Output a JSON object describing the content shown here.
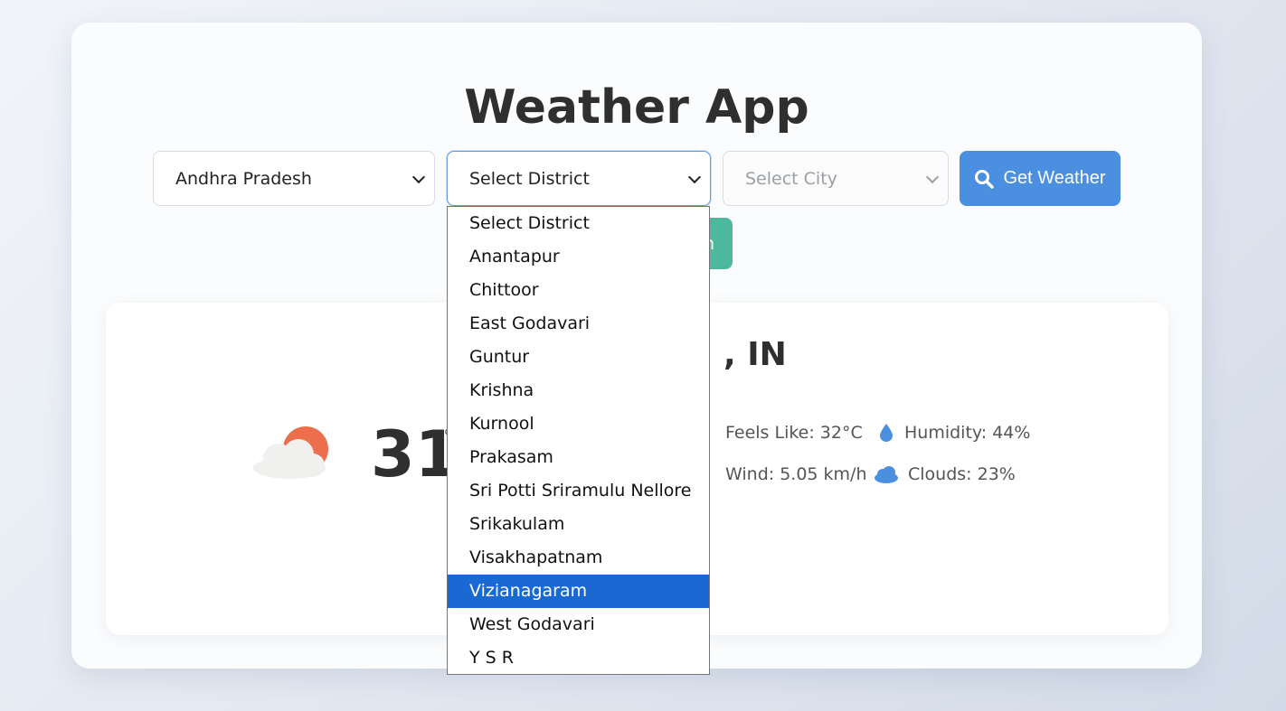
{
  "app": {
    "title": "Weather App"
  },
  "controls": {
    "state_value": "Andhra Pradesh",
    "district_value": "Select District",
    "city_placeholder": "Select City",
    "get_weather_label": "Get Weather",
    "teal_button_partial": "n"
  },
  "district_options": [
    "Select District",
    "Anantapur",
    "Chittoor",
    "East Godavari",
    "Guntur",
    "Krishna",
    "Kurnool",
    "Prakasam",
    "Sri Potti Sriramulu Nellore",
    "Srikakulam",
    "Visakhapatnam",
    "Vizianagaram",
    "West Godavari",
    "Y S R"
  ],
  "highlighted_option": "Vizianagaram",
  "weather": {
    "location_partial": ", IN",
    "temp_partial": "31",
    "temp_unit_partial": "°",
    "feels_like": "Feels Like: 32°C",
    "humidity": "Humidity: 44%",
    "wind": "Wind: 5.05 km/h",
    "clouds": "Clouds: 23%",
    "condition_icon": "partly-cloudy-icon"
  },
  "colors": {
    "primary": "#4a8fe0",
    "teal": "#4db89d",
    "highlight": "#1a68d2",
    "sun": "#ec6e4c"
  }
}
